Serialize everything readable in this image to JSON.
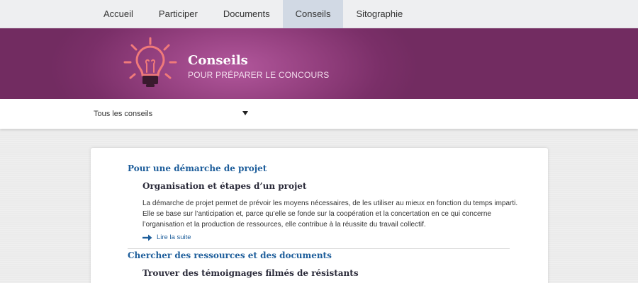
{
  "nav": {
    "items": [
      {
        "label": "Accueil"
      },
      {
        "label": "Participer"
      },
      {
        "label": "Documents"
      },
      {
        "label": "Conseils",
        "active": true
      },
      {
        "label": "Sitographie"
      }
    ]
  },
  "banner": {
    "icon": "lightbulb-icon",
    "title": "Conseils",
    "subtitle": "POUR PRÉPARER LE CONCOURS"
  },
  "filter": {
    "selected": "Tous les conseils"
  },
  "sections": [
    {
      "title": "Pour une démarche de projet",
      "article": {
        "title": "Organisation et étapes d’un projet",
        "text": "La démarche de projet permet de prévoir les moyens nécessaires, de les utiliser au mieux en fonction du temps imparti. Elle se base sur l’anticipation et, parce qu’elle se fonde sur la coopération et la concertation en ce qui concerne l’organisation et la production de ressources, elle contribue à la réussite du travail collectif.",
        "read_more": "Lire la suite"
      }
    },
    {
      "title": "Chercher des ressources et des documents",
      "article": {
        "title": "Trouver des témoignages filmés de résistants"
      }
    }
  ],
  "colors": {
    "banner_purple": "#7a2f68",
    "link_blue": "#1e5e9b",
    "nav_active": "#d1d9e4"
  }
}
